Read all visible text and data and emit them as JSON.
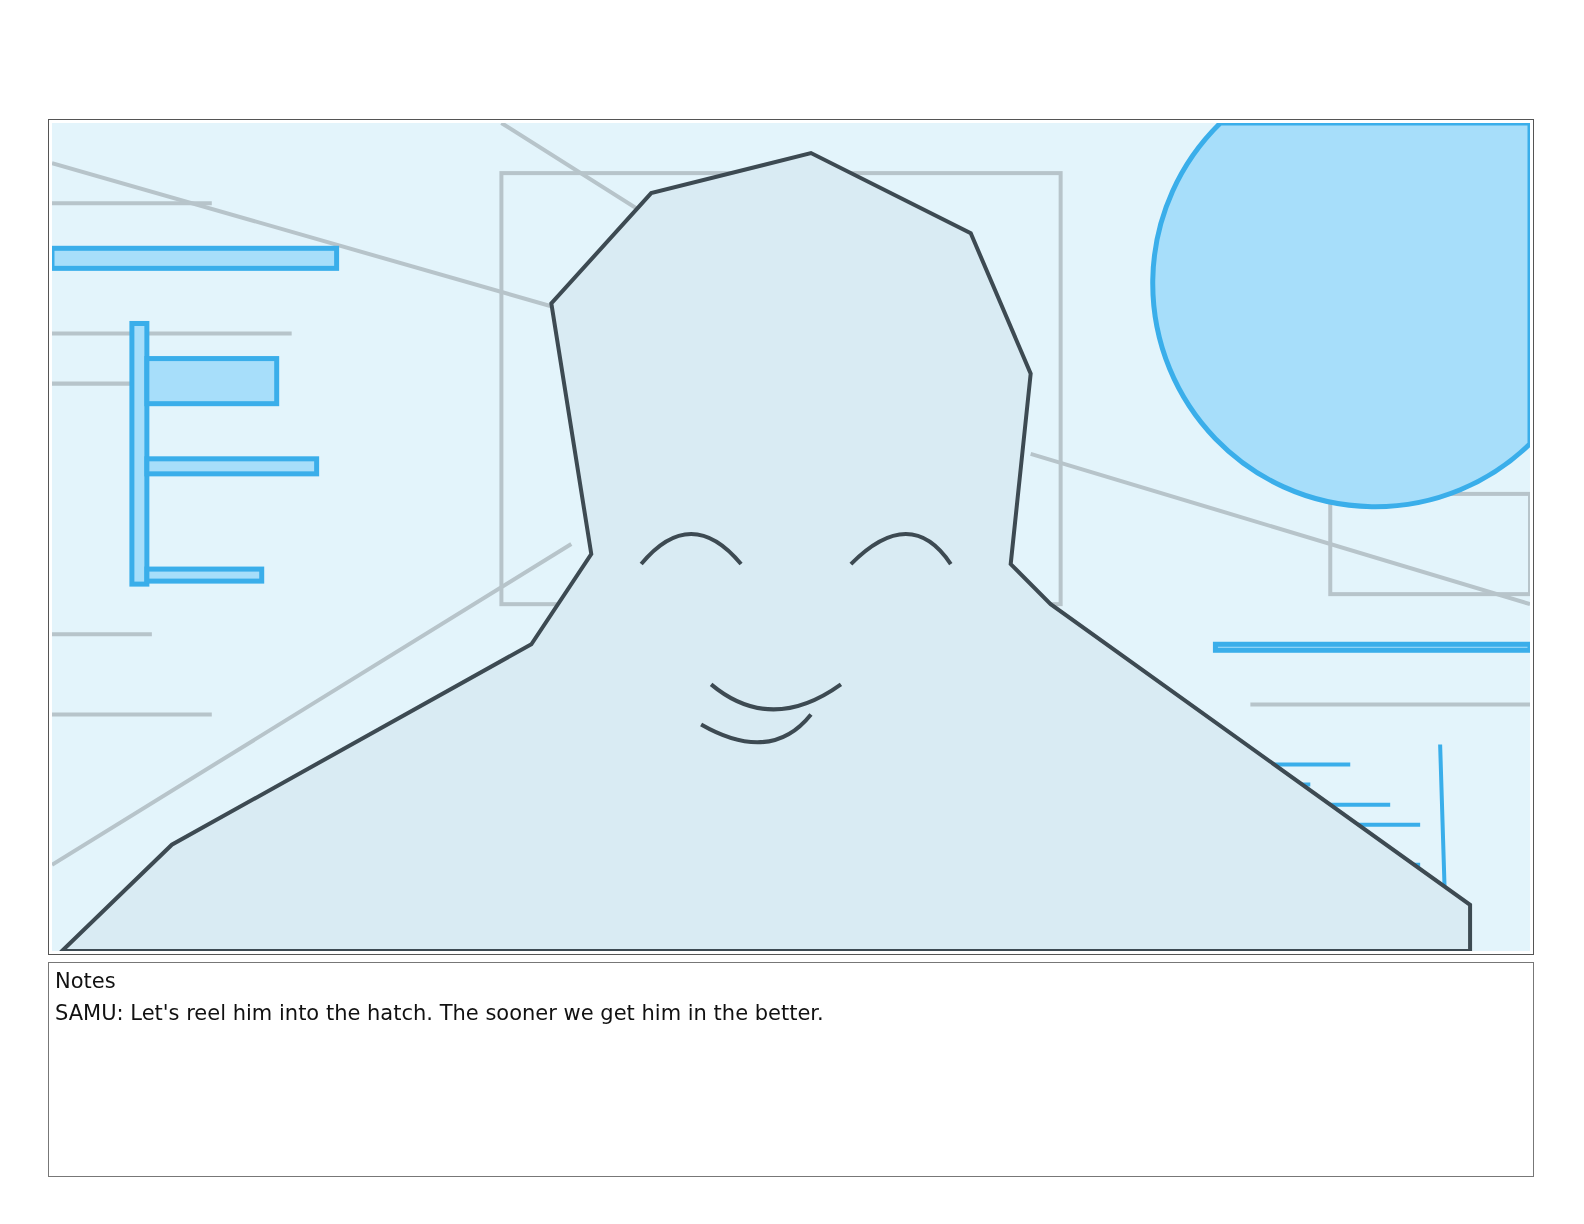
{
  "panel": {
    "kind": "sketch"
  },
  "notes": {
    "label": "Notes",
    "text": "SAMU: Let's reel him into the hatch. The sooner we get him in the better."
  }
}
